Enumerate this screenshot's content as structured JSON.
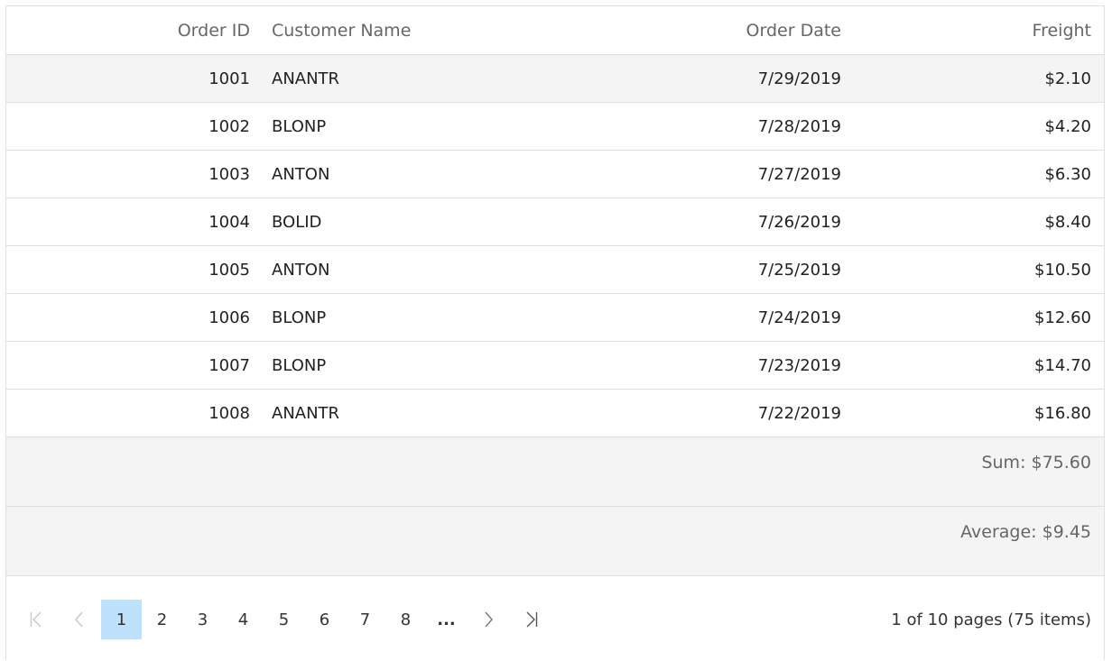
{
  "columns": {
    "order_id": "Order ID",
    "customer_name": "Customer Name",
    "order_date": "Order Date",
    "freight": "Freight"
  },
  "rows": [
    {
      "order_id": "1001",
      "customer_name": "ANANTR",
      "order_date": "7/29/2019",
      "freight": "$2.10"
    },
    {
      "order_id": "1002",
      "customer_name": "BLONP",
      "order_date": "7/28/2019",
      "freight": "$4.20"
    },
    {
      "order_id": "1003",
      "customer_name": "ANTON",
      "order_date": "7/27/2019",
      "freight": "$6.30"
    },
    {
      "order_id": "1004",
      "customer_name": "BOLID",
      "order_date": "7/26/2019",
      "freight": "$8.40"
    },
    {
      "order_id": "1005",
      "customer_name": "ANTON",
      "order_date": "7/25/2019",
      "freight": "$10.50"
    },
    {
      "order_id": "1006",
      "customer_name": "BLONP",
      "order_date": "7/24/2019",
      "freight": "$12.60"
    },
    {
      "order_id": "1007",
      "customer_name": "BLONP",
      "order_date": "7/23/2019",
      "freight": "$14.70"
    },
    {
      "order_id": "1008",
      "customer_name": "ANANTR",
      "order_date": "7/22/2019",
      "freight": "$16.80"
    }
  ],
  "aggregates": {
    "sum": "Sum: $75.60",
    "average": "Average: $9.45"
  },
  "pager": {
    "pages": [
      "1",
      "2",
      "3",
      "4",
      "5",
      "6",
      "7",
      "8"
    ],
    "current_page": "1",
    "more": "...",
    "info": "1 of 10 pages (75 items)",
    "icons": {
      "first": "first-page-icon",
      "prev": "previous-page-icon",
      "next": "next-page-icon",
      "last": "last-page-icon"
    },
    "active_color": "#bee1fc"
  },
  "colors": {
    "alt_row": "#f4f4f4",
    "border": "#e0e0e0",
    "header_text": "#666666"
  }
}
